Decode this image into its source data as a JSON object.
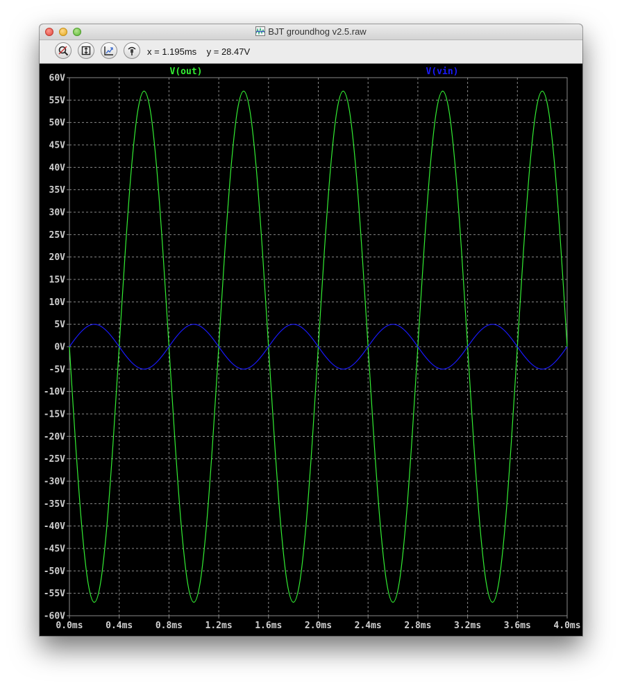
{
  "window": {
    "title": "BJT groundhog v2.5.raw"
  },
  "toolbar": {
    "buttons": [
      {
        "name": "zoom-icon"
      },
      {
        "name": "zoom-extents-icon"
      },
      {
        "name": "zoom-back-icon"
      },
      {
        "name": "probe-icon"
      }
    ],
    "x_readout": "x = 1.195ms",
    "y_readout": "y = 28.47V"
  },
  "colors": {
    "background": "#000000",
    "grid": "#8a8a8a",
    "axis_text": "#d0d0d0",
    "vout": "#33ee33",
    "vin": "#1a1aff"
  },
  "chart_data": {
    "type": "line",
    "xlabel": "",
    "ylabel": "",
    "xlim": [
      0,
      4.0
    ],
    "ylim": [
      -60,
      60
    ],
    "grid": true,
    "x_ticks": [
      "0.0ms",
      "0.4ms",
      "0.8ms",
      "1.2ms",
      "1.6ms",
      "2.0ms",
      "2.4ms",
      "2.8ms",
      "3.2ms",
      "3.6ms",
      "4.0ms"
    ],
    "y_ticks": [
      "60V",
      "55V",
      "50V",
      "45V",
      "40V",
      "35V",
      "30V",
      "25V",
      "20V",
      "15V",
      "10V",
      "5V",
      "0V",
      "-5V",
      "-10V",
      "-15V",
      "-20V",
      "-25V",
      "-30V",
      "-35V",
      "-40V",
      "-45V",
      "-50V",
      "-55V",
      "-60V"
    ],
    "series": [
      {
        "name": "V(out)",
        "color": "#33ee33",
        "x": [
          0,
          0.05,
          0.1,
          0.15,
          0.2,
          0.25,
          0.3,
          0.35,
          0.4,
          0.45,
          0.5,
          0.55,
          0.6,
          0.65,
          0.7,
          0.75,
          0.8,
          0.85,
          0.9,
          0.95,
          1.0,
          1.05,
          1.1,
          1.15,
          1.2,
          1.25,
          1.3,
          1.35,
          1.4,
          1.45,
          1.5,
          1.55,
          1.6,
          1.65,
          1.7,
          1.75,
          1.8,
          1.85,
          1.9,
          1.95,
          2.0,
          2.05,
          2.1,
          2.15,
          2.2,
          2.25,
          2.3,
          2.35,
          2.4,
          2.45,
          2.5,
          2.55,
          2.6,
          2.65,
          2.7,
          2.75,
          2.8,
          2.85,
          2.9,
          2.95,
          3.0,
          3.05,
          3.1,
          3.15,
          3.2,
          3.25,
          3.3,
          3.35,
          3.4,
          3.45,
          3.5,
          3.55,
          3.6,
          3.65,
          3.7,
          3.75,
          3.8,
          3.85,
          3.9,
          3.95,
          4.0
        ],
        "y": [
          0,
          -21.8,
          -40.3,
          -52.7,
          -57.0,
          -52.7,
          -40.3,
          -21.8,
          0,
          21.8,
          40.3,
          52.7,
          57.0,
          52.7,
          40.3,
          21.8,
          0,
          -21.8,
          -40.3,
          -52.7,
          -57.0,
          -52.7,
          -40.3,
          -21.8,
          0,
          21.8,
          40.3,
          52.7,
          57.0,
          52.7,
          40.3,
          21.8,
          0,
          -21.8,
          -40.3,
          -52.7,
          -57.0,
          -52.7,
          -40.3,
          -21.8,
          0,
          21.8,
          40.3,
          52.7,
          57.0,
          52.7,
          40.3,
          21.8,
          0,
          -21.8,
          -40.3,
          -52.7,
          -57.0,
          -52.7,
          -40.3,
          -21.8,
          0,
          21.8,
          40.3,
          52.7,
          57.0,
          52.7,
          40.3,
          21.8,
          0,
          -21.8,
          -40.3,
          -52.7,
          -57.0,
          -52.7,
          -40.3,
          -21.8,
          0,
          21.8,
          40.3,
          52.7,
          57.0,
          52.7,
          40.3,
          21.8,
          0
        ]
      },
      {
        "name": "V(vin)",
        "color": "#1a1aff",
        "x": [
          0,
          0.05,
          0.1,
          0.15,
          0.2,
          0.25,
          0.3,
          0.35,
          0.4,
          0.45,
          0.5,
          0.55,
          0.6,
          0.65,
          0.7,
          0.75,
          0.8,
          0.85,
          0.9,
          0.95,
          1.0,
          1.05,
          1.1,
          1.15,
          1.2,
          1.25,
          1.3,
          1.35,
          1.4,
          1.45,
          1.5,
          1.55,
          1.6,
          1.65,
          1.7,
          1.75,
          1.8,
          1.85,
          1.9,
          1.95,
          2.0,
          2.05,
          2.1,
          2.15,
          2.2,
          2.25,
          2.3,
          2.35,
          2.4,
          2.45,
          2.5,
          2.55,
          2.6,
          2.65,
          2.7,
          2.75,
          2.8,
          2.85,
          2.9,
          2.95,
          3.0,
          3.05,
          3.1,
          3.15,
          3.2,
          3.25,
          3.3,
          3.35,
          3.4,
          3.45,
          3.5,
          3.55,
          3.6,
          3.65,
          3.7,
          3.75,
          3.8,
          3.85,
          3.9,
          3.95,
          4.0
        ],
        "y": [
          0,
          1.9,
          3.5,
          4.6,
          5.0,
          4.6,
          3.5,
          1.9,
          0,
          -1.9,
          -3.5,
          -4.6,
          -5.0,
          -4.6,
          -3.5,
          -1.9,
          0,
          1.9,
          3.5,
          4.6,
          5.0,
          4.6,
          3.5,
          1.9,
          0,
          -1.9,
          -3.5,
          -4.6,
          -5.0,
          -4.6,
          -3.5,
          -1.9,
          0,
          1.9,
          3.5,
          4.6,
          5.0,
          4.6,
          3.5,
          1.9,
          0,
          -1.9,
          -3.5,
          -4.6,
          -5.0,
          -4.6,
          -3.5,
          -1.9,
          0,
          1.9,
          3.5,
          4.6,
          5.0,
          4.6,
          3.5,
          1.9,
          0,
          -1.9,
          -3.5,
          -4.6,
          -5.0,
          -4.6,
          -3.5,
          -1.9,
          0,
          1.9,
          3.5,
          4.6,
          5.0,
          4.6,
          3.5,
          1.9,
          0,
          -1.9,
          -3.5,
          -4.6,
          -5.0,
          -4.6,
          -3.5,
          -1.9,
          0
        ]
      }
    ]
  }
}
